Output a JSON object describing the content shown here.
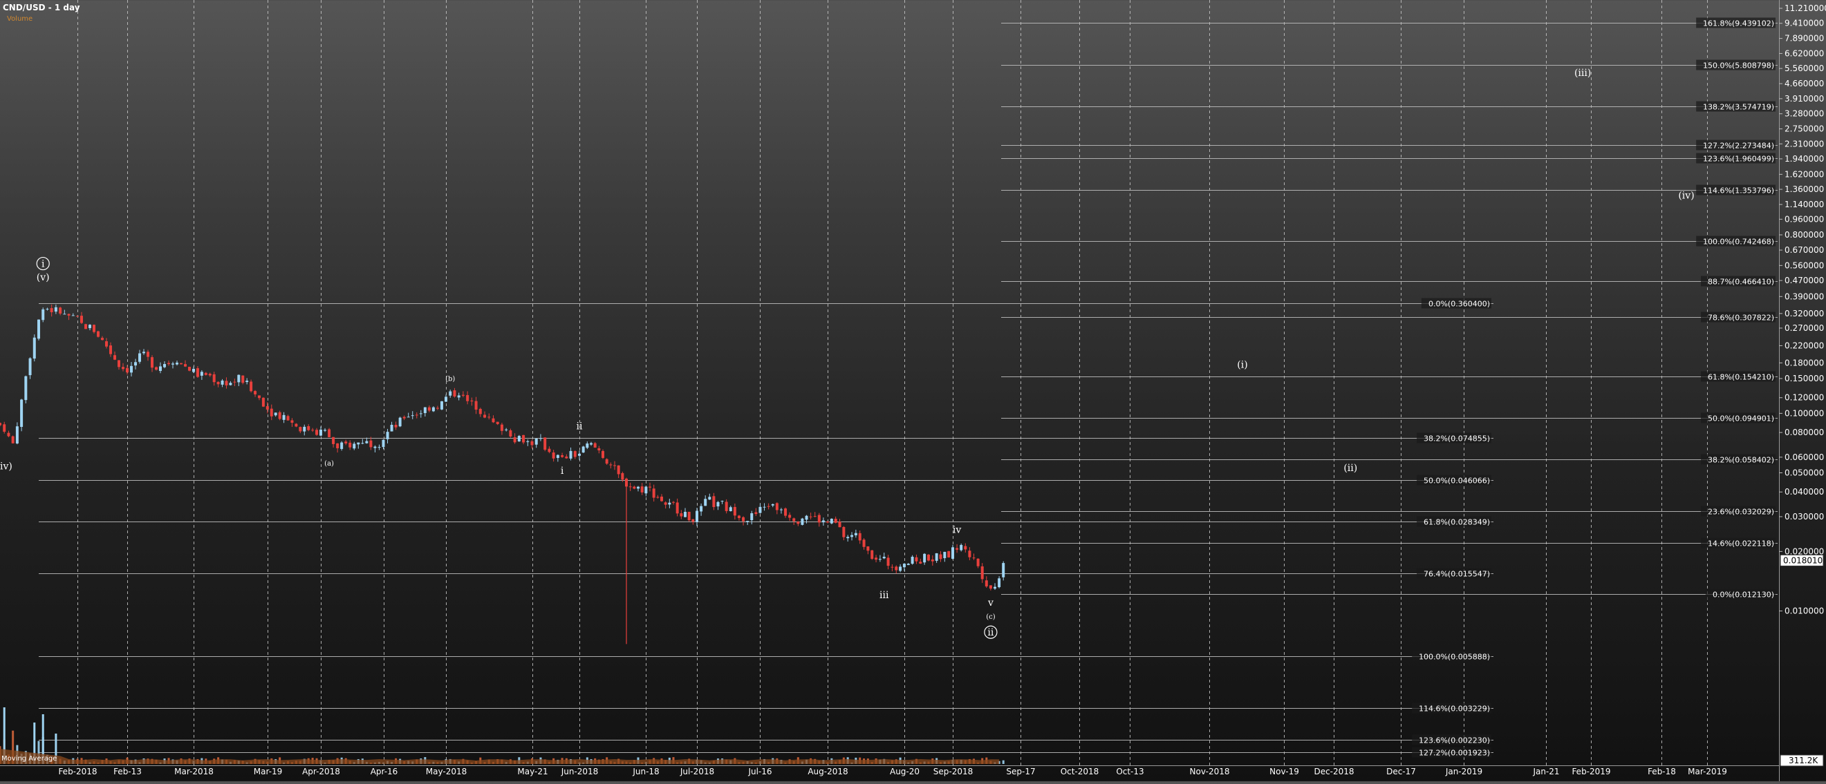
{
  "header": {
    "title": "CND/USD - 1 day",
    "volume_label": "Volume"
  },
  "footer": {
    "indicator_label": "Moving Average"
  },
  "colors": {
    "up_candle": "#9fd4f2",
    "down_candle": "#e8403c",
    "volume_up": "#9fd4f2",
    "volume_down": "#d2643a",
    "volume_area": "#8a4a1e",
    "fib_line": "#bdbdbd",
    "grid": "#c8c8c8",
    "price_box": "#ffffff"
  },
  "chart_data": {
    "type": "candlestick",
    "title": "CND/USD - 1 day",
    "y_scale": "log",
    "ylim": [
      0.0065,
      11.21
    ],
    "price_ticks": [
      "11.210000",
      "9.410000",
      "7.890000",
      "6.620000",
      "5.560000",
      "4.660000",
      "3.910000",
      "3.280000",
      "2.750000",
      "2.310000",
      "1.940000",
      "1.620000",
      "1.360000",
      "1.140000",
      "0.960000",
      "0.800000",
      "0.670000",
      "0.560000",
      "0.470000",
      "0.390000",
      "0.320000",
      "0.270000",
      "0.220000",
      "0.180000",
      "0.150000",
      "0.120000",
      "0.100000",
      "0.080000",
      "0.060000",
      "0.050000",
      "0.040000",
      "0.030000",
      "0.020000",
      "0.010000"
    ],
    "price_tick_values": [
      11.21,
      9.41,
      7.89,
      6.62,
      5.56,
      4.66,
      3.91,
      3.28,
      2.75,
      2.31,
      1.94,
      1.62,
      1.36,
      1.14,
      0.96,
      0.8,
      0.67,
      0.56,
      0.47,
      0.39,
      0.32,
      0.27,
      0.22,
      0.18,
      0.15,
      0.12,
      0.1,
      0.08,
      0.06,
      0.05,
      0.04,
      0.03,
      0.02,
      0.01
    ],
    "x_labels": [
      "Feb-2018",
      "Feb-13",
      "Mar-2018",
      "Mar-19",
      "Apr-2018",
      "Apr-16",
      "May-2018",
      "May-21",
      "Jun-2018",
      "Jun-18",
      "Jul-2018",
      "Jul-16",
      "Aug-2018",
      "Aug-20",
      "Sep-2018",
      "Sep-17",
      "Oct-2018",
      "Oct-13",
      "Nov-2018",
      "Nov-19",
      "Dec-2018",
      "Dec-17",
      "Jan-2019",
      "Jan-21",
      "Feb-2019",
      "Feb-18",
      "Mar-2019"
    ],
    "x_dates": [
      "2018-02-01",
      "2018-02-13",
      "2018-03-01",
      "2018-03-19",
      "2018-04-01",
      "2018-04-16",
      "2018-05-01",
      "2018-05-21",
      "2018-06-01",
      "2018-06-18",
      "2018-07-01",
      "2018-07-16",
      "2018-08-01",
      "2018-08-20",
      "2018-09-01",
      "2018-09-17",
      "2018-10-01",
      "2018-10-13",
      "2018-11-01",
      "2018-11-19",
      "2018-12-01",
      "2018-12-17",
      "2019-01-01",
      "2019-01-21",
      "2019-02-01",
      "2019-02-18",
      "2019-03-01"
    ],
    "grid": true,
    "last_price": "0.018010",
    "last_price_value": 0.01801,
    "volume_axis_label": "311.2K",
    "series_close": [
      [
        "2018-01-14",
        0.085
      ],
      [
        "2018-01-16",
        0.07
      ],
      [
        "2018-01-18",
        0.115
      ],
      [
        "2018-01-20",
        0.2
      ],
      [
        "2018-01-22",
        0.3
      ],
      [
        "2018-01-24",
        0.34
      ],
      [
        "2018-01-26",
        0.33
      ],
      [
        "2018-01-28",
        0.31
      ],
      [
        "2018-01-30",
        0.3
      ],
      [
        "2018-02-01",
        0.28
      ],
      [
        "2018-02-03",
        0.27
      ],
      [
        "2018-02-05",
        0.25
      ],
      [
        "2018-02-07",
        0.22
      ],
      [
        "2018-02-09",
        0.19
      ],
      [
        "2018-02-11",
        0.17
      ],
      [
        "2018-02-13",
        0.17
      ],
      [
        "2018-02-15",
        0.19
      ],
      [
        "2018-02-17",
        0.18
      ],
      [
        "2018-02-20",
        0.18
      ],
      [
        "2018-02-23",
        0.19
      ],
      [
        "2018-02-26",
        0.17
      ],
      [
        "2018-03-01",
        0.155
      ],
      [
        "2018-03-04",
        0.15
      ],
      [
        "2018-03-07",
        0.145
      ],
      [
        "2018-03-10",
        0.15
      ],
      [
        "2018-03-13",
        0.13
      ],
      [
        "2018-03-16",
        0.115
      ],
      [
        "2018-03-19",
        0.1
      ],
      [
        "2018-03-22",
        0.095
      ],
      [
        "2018-03-25",
        0.085
      ],
      [
        "2018-03-28",
        0.085
      ],
      [
        "2018-03-31",
        0.08
      ],
      [
        "2018-04-03",
        0.065
      ],
      [
        "2018-04-06",
        0.07
      ],
      [
        "2018-04-09",
        0.073
      ],
      [
        "2018-04-12",
        0.072
      ],
      [
        "2018-04-15",
        0.08
      ],
      [
        "2018-04-18",
        0.09
      ],
      [
        "2018-04-21",
        0.1
      ],
      [
        "2018-04-24",
        0.105
      ],
      [
        "2018-04-27",
        0.11
      ],
      [
        "2018-04-30",
        0.12
      ],
      [
        "2018-05-02",
        0.13
      ],
      [
        "2018-05-05",
        0.11
      ],
      [
        "2018-05-08",
        0.1
      ],
      [
        "2018-05-11",
        0.085
      ],
      [
        "2018-05-14",
        0.08
      ],
      [
        "2018-05-17",
        0.075
      ],
      [
        "2018-05-20",
        0.072
      ],
      [
        "2018-05-23",
        0.065
      ],
      [
        "2018-05-26",
        0.058
      ],
      [
        "2018-05-29",
        0.062
      ],
      [
        "2018-06-01",
        0.068
      ],
      [
        "2018-06-04",
        0.065
      ],
      [
        "2018-06-07",
        0.055
      ],
      [
        "2018-06-10",
        0.045
      ],
      [
        "2018-06-13",
        0.042
      ],
      [
        "2018-06-16",
        0.042
      ],
      [
        "2018-06-19",
        0.038
      ],
      [
        "2018-06-22",
        0.034
      ],
      [
        "2018-06-25",
        0.032
      ],
      [
        "2018-06-28",
        0.03
      ],
      [
        "2018-07-01",
        0.035
      ],
      [
        "2018-07-04",
        0.034
      ],
      [
        "2018-07-07",
        0.032
      ],
      [
        "2018-07-10",
        0.03
      ],
      [
        "2018-07-13",
        0.031
      ],
      [
        "2018-07-16",
        0.035
      ],
      [
        "2018-07-19",
        0.033
      ],
      [
        "2018-07-22",
        0.03
      ],
      [
        "2018-07-25",
        0.031
      ],
      [
        "2018-07-28",
        0.029
      ],
      [
        "2018-07-31",
        0.028
      ],
      [
        "2018-08-03",
        0.024
      ],
      [
        "2018-08-06",
        0.024
      ],
      [
        "2018-08-09",
        0.021
      ],
      [
        "2018-08-12",
        0.018
      ],
      [
        "2018-08-15",
        0.017
      ],
      [
        "2018-08-18",
        0.018
      ],
      [
        "2018-08-21",
        0.018
      ],
      [
        "2018-08-24",
        0.019
      ],
      [
        "2018-08-27",
        0.019
      ],
      [
        "2018-08-30",
        0.02
      ],
      [
        "2018-09-02",
        0.021
      ],
      [
        "2018-09-05",
        0.017
      ],
      [
        "2018-09-08",
        0.014
      ],
      [
        "2018-09-10",
        0.013
      ],
      [
        "2018-09-12",
        0.018
      ]
    ],
    "fib_levels_left": [
      {
        "label": "0.0%(0.360400)",
        "value": 0.3604
      },
      {
        "label": "38.2%(0.074855)",
        "value": 0.074855
      },
      {
        "label": "50.0%(0.046066)",
        "value": 0.046066
      },
      {
        "label": "61.8%(0.028349)",
        "value": 0.028349
      },
      {
        "label": "76.4%(0.015547)",
        "value": 0.015547
      },
      {
        "label": "100.0%(0.005888)",
        "value": 0.005888
      },
      {
        "label": "114.6%(0.003229)",
        "value": 0.003229
      },
      {
        "label": "123.6%(0.002230)",
        "value": 0.00223
      },
      {
        "label": "127.2%(0.001923)",
        "value": 0.001923
      }
    ],
    "fib_levels_right": [
      {
        "label": "161.8%(9.439102)",
        "value": 9.439102
      },
      {
        "label": "150.0%(5.808798)",
        "value": 5.808798
      },
      {
        "label": "138.2%(3.574719)",
        "value": 3.574719
      },
      {
        "label": "127.2%(2.273484)",
        "value": 2.273484
      },
      {
        "label": "123.6%(1.960499)",
        "value": 1.960499
      },
      {
        "label": "114.6%(1.353796)",
        "value": 1.353796
      },
      {
        "label": "100.0%(0.742468)",
        "value": 0.742468
      },
      {
        "label": "88.7%(0.466410)",
        "value": 0.46641
      },
      {
        "label": "78.6%(0.307822)",
        "value": 0.307822
      },
      {
        "label": "61.8%(0.154210)",
        "value": 0.15421
      },
      {
        "label": "50.0%(0.094901)",
        "value": 0.094901
      },
      {
        "label": "38.2%(0.058402)",
        "value": 0.058402
      },
      {
        "label": "23.6%(0.032029)",
        "value": 0.032029
      },
      {
        "label": "14.6%(0.022118)",
        "value": 0.022118
      },
      {
        "label": "0.0%(0.012130)",
        "value": 0.01213
      }
    ],
    "wave_labels": [
      {
        "text": "(iv)",
        "date": "2018-01-15",
        "value": 0.052,
        "size": "md"
      },
      {
        "text": "(v)",
        "date": "2018-01-24",
        "value": 0.47,
        "size": "md"
      },
      {
        "text": "i",
        "date": "2018-01-24",
        "value": 0.55,
        "size": "md",
        "circled": true
      },
      {
        "text": "(a)",
        "date": "2018-04-03",
        "value": 0.0545,
        "size": "sm"
      },
      {
        "text": "(b)",
        "date": "2018-05-02",
        "value": 0.146,
        "size": "sm"
      },
      {
        "text": "i",
        "date": "2018-05-28",
        "value": 0.0495,
        "size": "md"
      },
      {
        "text": "ii",
        "date": "2018-06-01",
        "value": 0.083,
        "size": "md"
      },
      {
        "text": "iii",
        "date": "2018-08-15",
        "value": 0.0116,
        "size": "md"
      },
      {
        "text": "iv",
        "date": "2018-09-02",
        "value": 0.0248,
        "size": "md"
      },
      {
        "text": "v",
        "date": "2018-09-10",
        "value": 0.0106,
        "size": "md"
      },
      {
        "text": "(c)",
        "date": "2018-09-10",
        "value": 0.0091,
        "size": "sm"
      },
      {
        "text": "ii",
        "date": "2018-09-10",
        "value": 0.0075,
        "size": "md",
        "circled": true
      },
      {
        "text": "(i)",
        "date": "2018-11-09",
        "value": 0.17,
        "size": "md"
      },
      {
        "text": "(ii)",
        "date": "2018-12-05",
        "value": 0.051,
        "size": "md"
      },
      {
        "text": "(iii)",
        "date": "2019-01-30",
        "value": 5.1,
        "size": "md"
      },
      {
        "text": "(iv)",
        "date": "2019-02-24",
        "value": 1.22,
        "size": "md"
      }
    ]
  }
}
